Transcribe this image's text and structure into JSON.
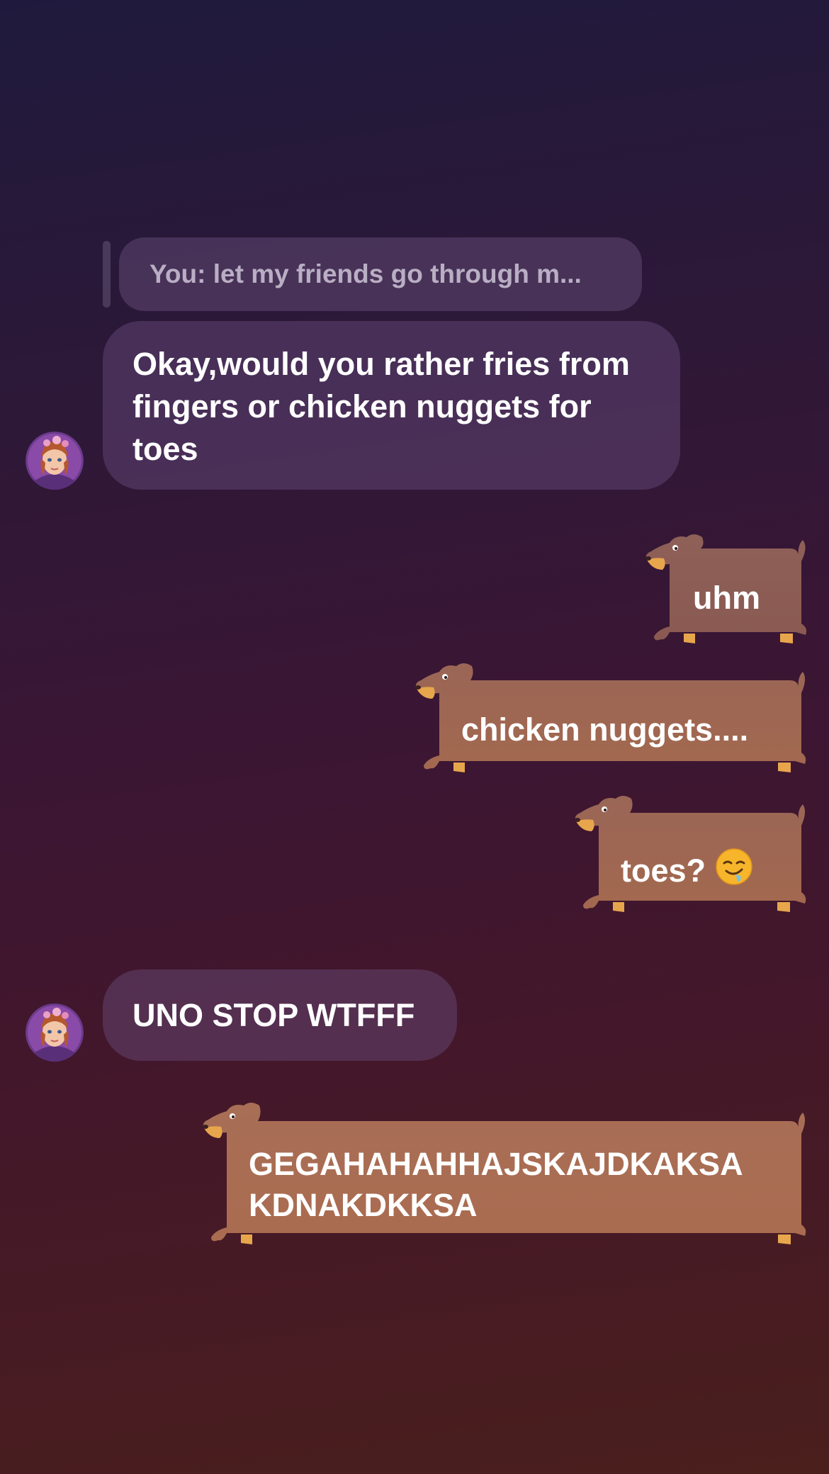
{
  "reply": {
    "quote_text": "You: let my friends go through m..."
  },
  "messages": {
    "incoming_1": "Okay,would you rather fries from fingers or chicken nuggets for toes",
    "outgoing_1": "uhm",
    "outgoing_2": "chicken nuggets....",
    "outgoing_3": "toes?",
    "outgoing_3_emoji": "drooling-face",
    "incoming_2": "UNO STOP WTFFF",
    "outgoing_4": "GEGAHAHAHHAJSKAJDKAKSA KDNAKDKKSA"
  },
  "colors": {
    "incoming_bubble": "#5a3f6a",
    "dog_bubble_brown": "#8e5e55",
    "dog_bubble_orange": "#a8694f",
    "dog_paws": "#e8a64c"
  }
}
